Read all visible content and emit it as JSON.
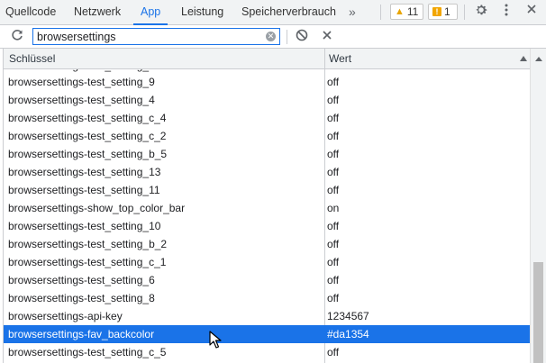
{
  "tabs": [
    {
      "label": "Quellcode",
      "active": false
    },
    {
      "label": "Netzwerk",
      "active": false
    },
    {
      "label": "App",
      "active": true
    },
    {
      "label": "Leistung",
      "active": false
    },
    {
      "label": "Speicherverbrauch",
      "active": false
    }
  ],
  "more_tabs_label": "»",
  "badges": {
    "warnings": "11",
    "issues": "1"
  },
  "filter": {
    "value": "browsersettings"
  },
  "table": {
    "col_key": "Schlüssel",
    "col_value": "Wert",
    "rows": [
      {
        "key": "browsersettings-test_setting_9",
        "value": "off"
      },
      {
        "key": "browsersettings-test_setting_4",
        "value": "off"
      },
      {
        "key": "browsersettings-test_setting_c_4",
        "value": "off"
      },
      {
        "key": "browsersettings-test_setting_c_2",
        "value": "off"
      },
      {
        "key": "browsersettings-test_setting_b_5",
        "value": "off"
      },
      {
        "key": "browsersettings-test_setting_13",
        "value": "off"
      },
      {
        "key": "browsersettings-test_setting_11",
        "value": "off"
      },
      {
        "key": "browsersettings-show_top_color_bar",
        "value": "on"
      },
      {
        "key": "browsersettings-test_setting_10",
        "value": "off"
      },
      {
        "key": "browsersettings-test_setting_b_2",
        "value": "off"
      },
      {
        "key": "browsersettings-test_setting_c_1",
        "value": "off"
      },
      {
        "key": "browsersettings-test_setting_6",
        "value": "off"
      },
      {
        "key": "browsersettings-test_setting_8",
        "value": "off"
      },
      {
        "key": "browsersettings-api-key",
        "value": "1234567"
      },
      {
        "key": "browsersettings-fav_backcolor",
        "value": "#da1354"
      },
      {
        "key": "browsersettings-test_setting_c_5",
        "value": "off"
      }
    ]
  },
  "icons": {
    "refresh": "refresh-icon",
    "clear": "clear-filter-icon",
    "block": "block-icon",
    "close": "close-icon",
    "settings": "gear-icon",
    "menu": "kebab-menu-icon"
  },
  "colors": {
    "accent": "#1a73e8",
    "selected_row": "#1a73e8",
    "warning": "#f2a600"
  }
}
